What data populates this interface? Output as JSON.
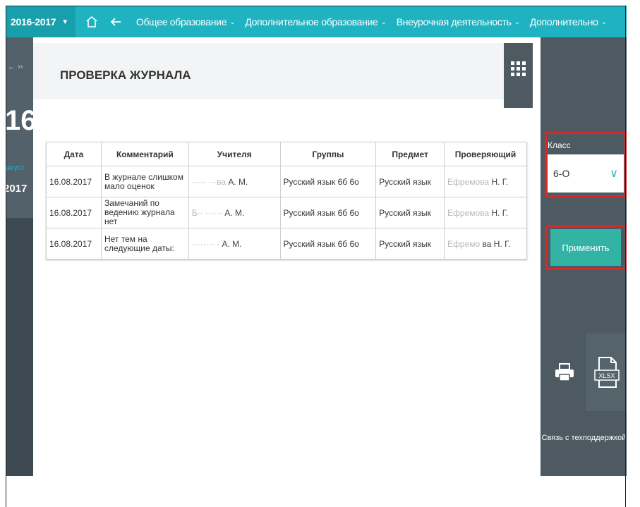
{
  "topbar": {
    "year": "2016-2017",
    "menu": [
      {
        "label": "Общее образование"
      },
      {
        "label": "Дополнительное образование"
      },
      {
        "label": "Внеурочная деятельность"
      },
      {
        "label": "Дополнительно"
      }
    ]
  },
  "leftbar": {
    "arrows": "← ››",
    "day": "16",
    "month": "август",
    "year": "2017"
  },
  "page": {
    "title": "ПРОВЕРКА ЖУРНАЛА"
  },
  "table": {
    "headers": [
      "Дата",
      "Комментарий",
      "Учителя",
      "Группы",
      "Предмет",
      "Проверяющий"
    ],
    "rows": [
      {
        "date": "16.08.2017",
        "comment": "В журнале слишком мало оценок",
        "teacher_blur": "····· ···ва",
        "teacher": "А. М.",
        "group": "Русский язык 6б 6о",
        "subject": "Русский язык",
        "checker_blur": "Ефремова",
        "checker": "Н. Г."
      },
      {
        "date": "16.08.2017",
        "comment": "Замечаний по ведению журнала нет",
        "teacher_blur": "Б·· ······",
        "teacher": "А. М.",
        "group": "Русский язык 6б 6о",
        "subject": "Русский язык",
        "checker_blur": "Ефремова",
        "checker": "Н. Г."
      },
      {
        "date": "16.08.2017",
        "comment": "Нет тем на следующие даты:",
        "teacher_blur": "········ ·",
        "teacher": "А. М.",
        "group": "Русский язык 6б 6о",
        "subject": "Русский язык",
        "checker_blur": "Ефремо",
        "checker": "ва Н. Г."
      }
    ]
  },
  "rightbar": {
    "class_label": "Класс",
    "class_value": "6-О",
    "apply_label": "Применить",
    "xlsx_label": "XLSX",
    "support_label": "Связь с техподдержкой"
  },
  "colors": {
    "topbar": "#1fb3c1",
    "sidebar": "#4d5a62",
    "apply": "#33b3a6",
    "highlight": "#d62a2a"
  }
}
